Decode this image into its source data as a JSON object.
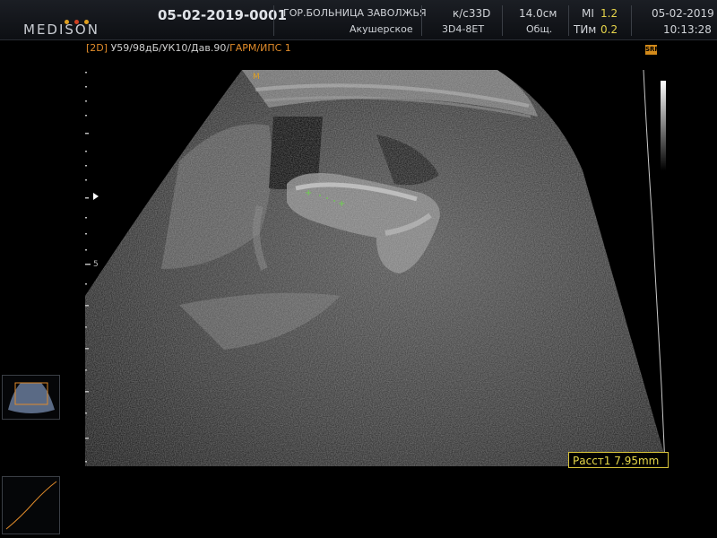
{
  "header": {
    "brand": "MEDISON",
    "patient_id": "05-02-2019-0001",
    "hospital": "ГОР.БОЛЬНИЦА ЗАВОЛЖЬЯ",
    "exam_type": "Акушерское",
    "app_label": "к/с33D",
    "probe": "3D4-8ET",
    "depth": "14.0см",
    "preset": "Общ.",
    "mi_label": "MI",
    "mi_value": "1.2",
    "tim_label": "ТИм",
    "tim_value": "0.2",
    "date": "05-02-2019",
    "time": "10:13:28"
  },
  "params": {
    "mode": "[2D]",
    "settings": "У59/98дБ/УК10/Дав.90/",
    "harmonic": "ГАРМ/ИПС 1"
  },
  "scale": {
    "mark_5": "5",
    "focus_marker": "M"
  },
  "measurement": {
    "label": "Расст1",
    "value": "7.95mm"
  },
  "icons": {
    "srf": "SRF"
  },
  "colors": {
    "accent_yellow": "#e8d94a",
    "accent_orange": "#e08b2a",
    "caliper_green": "#6bd04a"
  }
}
